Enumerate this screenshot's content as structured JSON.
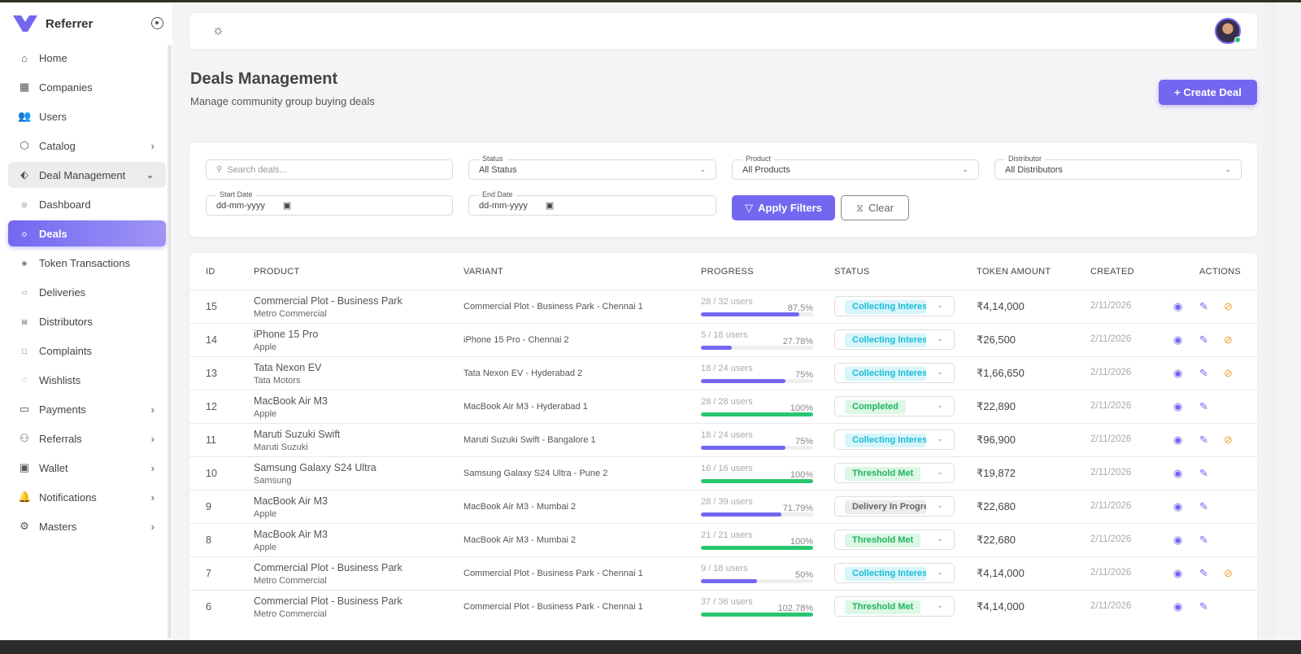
{
  "app": {
    "name": "Referrer",
    "brand_color": "#7367f0"
  },
  "sidebar": {
    "items": [
      {
        "label": "Home",
        "icon": "home-icon",
        "glyph": "⌂"
      },
      {
        "label": "Companies",
        "icon": "building-icon",
        "glyph": "▦"
      },
      {
        "label": "Users",
        "icon": "users-icon",
        "glyph": "👥"
      },
      {
        "label": "Catalog",
        "icon": "box-icon",
        "glyph": "⬡",
        "chevron": "›"
      },
      {
        "label": "Deal Management",
        "icon": "tag-icon",
        "glyph": "⬖",
        "chevron": "⌄",
        "state": "open"
      },
      {
        "label": "Dashboard",
        "icon": "dashboard-icon",
        "glyph": "◎",
        "sub": true
      },
      {
        "label": "Deals",
        "icon": "tag-icon",
        "glyph": "◇",
        "sub": true,
        "state": "active"
      },
      {
        "label": "Token Transactions",
        "icon": "coin-icon",
        "glyph": "◉",
        "sub": true
      },
      {
        "label": "Deliveries",
        "icon": "truck-icon",
        "glyph": "▭",
        "sub": true
      },
      {
        "label": "Distributors",
        "icon": "store-icon",
        "glyph": "▤",
        "sub": true
      },
      {
        "label": "Complaints",
        "icon": "message-icon",
        "glyph": "▢",
        "sub": true
      },
      {
        "label": "Wishlists",
        "icon": "heart-icon",
        "glyph": "♡",
        "sub": true
      },
      {
        "label": "Payments",
        "icon": "credit-card-icon",
        "glyph": "▭",
        "chevron": "›"
      },
      {
        "label": "Referrals",
        "icon": "referral-icon",
        "glyph": "⚇",
        "chevron": "›"
      },
      {
        "label": "Wallet",
        "icon": "wallet-icon",
        "glyph": "▣",
        "chevron": "›"
      },
      {
        "label": "Notifications",
        "icon": "bell-icon",
        "glyph": "🔔",
        "chevron": "›"
      },
      {
        "label": "Masters",
        "icon": "gear-icon",
        "glyph": "⚙",
        "chevron": "›"
      }
    ]
  },
  "page": {
    "title": "Deals Management",
    "subtitle": "Manage community group buying deals",
    "create_label": "+ Create Deal"
  },
  "filters": {
    "search_placeholder": "Search deals...",
    "status_label": "Status",
    "status_value": "All Status",
    "product_label": "Product",
    "product_value": "All Products",
    "distributor_label": "Distributor",
    "distributor_value": "All Distributors",
    "start_label": "Start Date",
    "start_value": "dd-mm-yyyy",
    "end_label": "End Date",
    "end_value": "dd-mm-yyyy",
    "apply_label": "Apply Filters",
    "clear_label": "Clear"
  },
  "table": {
    "headers": [
      "ID",
      "PRODUCT",
      "VARIANT",
      "PROGRESS",
      "STATUS",
      "TOKEN AMOUNT",
      "CREATED",
      "ACTIONS"
    ],
    "status_colors": {
      "Collecting Interest": [
        "#d7f5fa",
        "#1bbcd6"
      ],
      "Completed": [
        "#dcf7e6",
        "#22b35e"
      ],
      "Threshold Met": [
        "#dcf7e6",
        "#22b35e"
      ],
      "Delivery In Progress": [
        "#ececec",
        "#666"
      ]
    },
    "rows": [
      {
        "id": "15",
        "product": "Commercial Plot - Business Park",
        "brand": "Metro Commercial",
        "variant": "Commercial Plot - Business Park - Chennai 1",
        "users": "28 / 32 users",
        "pct": "87.5%",
        "progress": 87.5,
        "status": "Collecting Interest",
        "amount": "₹4,14,000",
        "created": "2/11/2026",
        "cancel": true
      },
      {
        "id": "14",
        "product": "iPhone 15 Pro",
        "brand": "Apple",
        "variant": "iPhone 15 Pro - Chennai 2",
        "users": "5 / 18 users",
        "pct": "27.78%",
        "progress": 27.78,
        "status": "Collecting Interest",
        "amount": "₹26,500",
        "created": "2/11/2026",
        "cancel": true
      },
      {
        "id": "13",
        "product": "Tata Nexon EV",
        "brand": "Tata Motors",
        "variant": "Tata Nexon EV - Hyderabad 2",
        "users": "18 / 24 users",
        "pct": "75%",
        "progress": 75,
        "status": "Collecting Interest",
        "amount": "₹1,66,650",
        "created": "2/11/2026",
        "cancel": true
      },
      {
        "id": "12",
        "product": "MacBook Air M3",
        "brand": "Apple",
        "variant": "MacBook Air M3 - Hyderabad 1",
        "users": "28 / 28 users",
        "pct": "100%",
        "progress": 100,
        "status": "Completed",
        "amount": "₹22,890",
        "created": "2/11/2026",
        "cancel": false
      },
      {
        "id": "11",
        "product": "Maruti Suzuki Swift",
        "brand": "Maruti Suzuki",
        "variant": "Maruti Suzuki Swift - Bangalore 1",
        "users": "18 / 24 users",
        "pct": "75%",
        "progress": 75,
        "status": "Collecting Interest",
        "amount": "₹96,900",
        "created": "2/11/2026",
        "cancel": true
      },
      {
        "id": "10",
        "product": "Samsung Galaxy S24 Ultra",
        "brand": "Samsung",
        "variant": "Samsung Galaxy S24 Ultra - Pune 2",
        "users": "16 / 16 users",
        "pct": "100%",
        "progress": 100,
        "status": "Threshold Met",
        "amount": "₹19,872",
        "created": "2/11/2026",
        "cancel": false
      },
      {
        "id": "9",
        "product": "MacBook Air M3",
        "brand": "Apple",
        "variant": "MacBook Air M3 - Mumbai 2",
        "users": "28 / 39 users",
        "pct": "71.79%",
        "progress": 71.79,
        "status": "Delivery In Progress",
        "amount": "₹22,680",
        "created": "2/11/2026",
        "cancel": false
      },
      {
        "id": "8",
        "product": "MacBook Air M3",
        "brand": "Apple",
        "variant": "MacBook Air M3 - Mumbai 2",
        "users": "21 / 21 users",
        "pct": "100%",
        "progress": 100,
        "status": "Threshold Met",
        "amount": "₹22,680",
        "created": "2/11/2026",
        "cancel": false
      },
      {
        "id": "7",
        "product": "Commercial Plot - Business Park",
        "brand": "Metro Commercial",
        "variant": "Commercial Plot - Business Park - Chennai 1",
        "users": "9 / 18 users",
        "pct": "50%",
        "progress": 50,
        "status": "Collecting Interest",
        "amount": "₹4,14,000",
        "created": "2/11/2026",
        "cancel": true
      },
      {
        "id": "6",
        "product": "Commercial Plot - Business Park",
        "brand": "Metro Commercial",
        "variant": "Commercial Plot - Business Park - Chennai 1",
        "users": "37 / 36 users",
        "pct": "102.78%",
        "progress": 102.78,
        "status": "Threshold Met",
        "amount": "₹4,14,000",
        "created": "2/11/2026",
        "cancel": false
      }
    ]
  }
}
